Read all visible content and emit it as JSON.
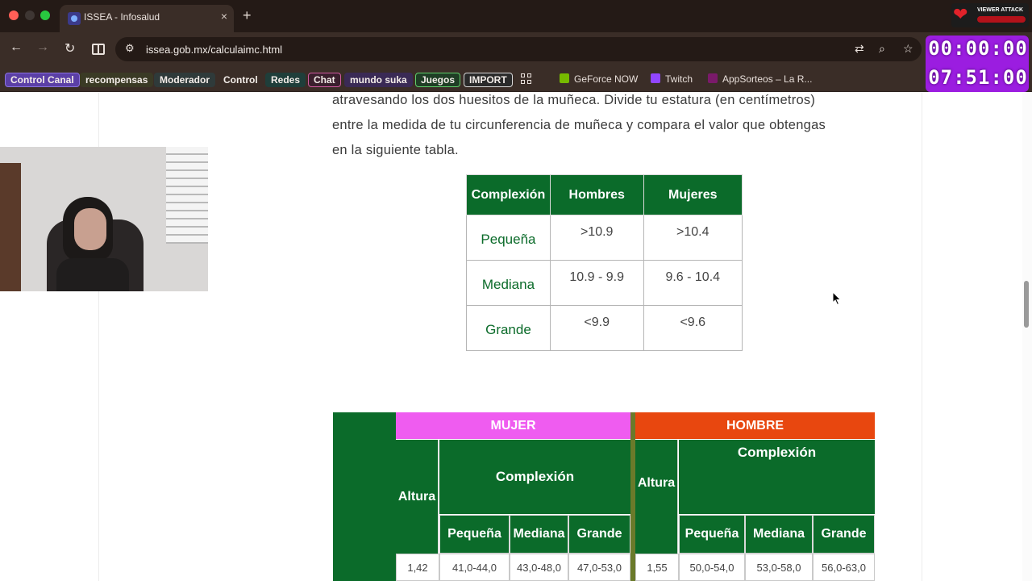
{
  "browser": {
    "tab_title": "ISSEA - Infosalud",
    "tab_close": "×",
    "new_tab": "+",
    "url": "issea.gob.mx/calculaimc.html",
    "nav": {
      "back": "←",
      "forward": "→",
      "reload": "↻"
    },
    "omnibox_icons": [
      "translate-icon",
      "zoom-icon",
      "star-icon"
    ],
    "bookmarks": [
      {
        "label": "Control Canal",
        "color": "#5b3fa6",
        "border": "#8a72e0"
      },
      {
        "label": "recompensas",
        "color": "#3a3a25",
        "border": "#3a3a25"
      },
      {
        "label": "Moderador",
        "color": "#2f3a3a",
        "border": "#2f3a3a"
      },
      {
        "label": "Control",
        "color": "#3a2d27",
        "border": "#3a2d27"
      },
      {
        "label": "Redes",
        "color": "#1f3e3a",
        "border": "#1f3e3a"
      },
      {
        "label": "Chat",
        "color": "#3a1f2d",
        "border": "#d05aa0"
      },
      {
        "label": "mundo suka",
        "color": "#3a2a55",
        "border": "#3a2a55"
      },
      {
        "label": "Juegos",
        "color": "#1f3e25",
        "border": "#5fcf6a"
      },
      {
        "label": "IMPORT",
        "color": "#2a2a2a",
        "border": "#d8d8d8"
      }
    ],
    "bookmarks_plain": [
      {
        "label": "GeForce NOW",
        "icon_color": "#76b900"
      },
      {
        "label": "Twitch",
        "icon_color": "#9146ff"
      },
      {
        "label": "AppSorteos – La R...",
        "icon_color": "#7a1a6a"
      }
    ]
  },
  "overlay": {
    "timer_top": "00:00:00",
    "timer_bottom": "07:51:00",
    "viewer_attack": "VIEWER ATTACK"
  },
  "content": {
    "para_1": "atravesando los dos huesitos de la muñeca. Divide tu estatura (en centímetros)",
    "para_2": "entre la medida de tu circunferencia de muñeca y compara el valor que obtengas",
    "para_3": "en la siguiente tabla.",
    "complexion_table": {
      "headers": [
        "Complexión",
        "Hombres",
        "Mujeres"
      ],
      "rows": [
        [
          "Pequeña",
          ">10.9",
          ">10.4"
        ],
        [
          "Mediana",
          "10.9 - 9.9",
          "9.6 - 10.4"
        ],
        [
          "Grande",
          "<9.9",
          "<9.6"
        ]
      ]
    },
    "weight_table": {
      "mujer": {
        "label": "MUJER",
        "color": "#ef5cf0",
        "altura": "Altura",
        "complexion": "Complexión",
        "cols": [
          "Pequeña",
          "Mediana",
          "Grande"
        ],
        "row": [
          "1,42",
          "41,0-44,0",
          "43,0-48,0",
          "47,0-53,0"
        ]
      },
      "hombre": {
        "label": "HOMBRE",
        "color": "#e8470f",
        "altura": "Altura",
        "complexion": "Complexión",
        "cols": [
          "Pequeña",
          "Mediana",
          "Grande"
        ],
        "row": [
          "1,55",
          "50,0-54,0",
          "53,0-58,0",
          "56,0-63,0"
        ]
      }
    }
  }
}
